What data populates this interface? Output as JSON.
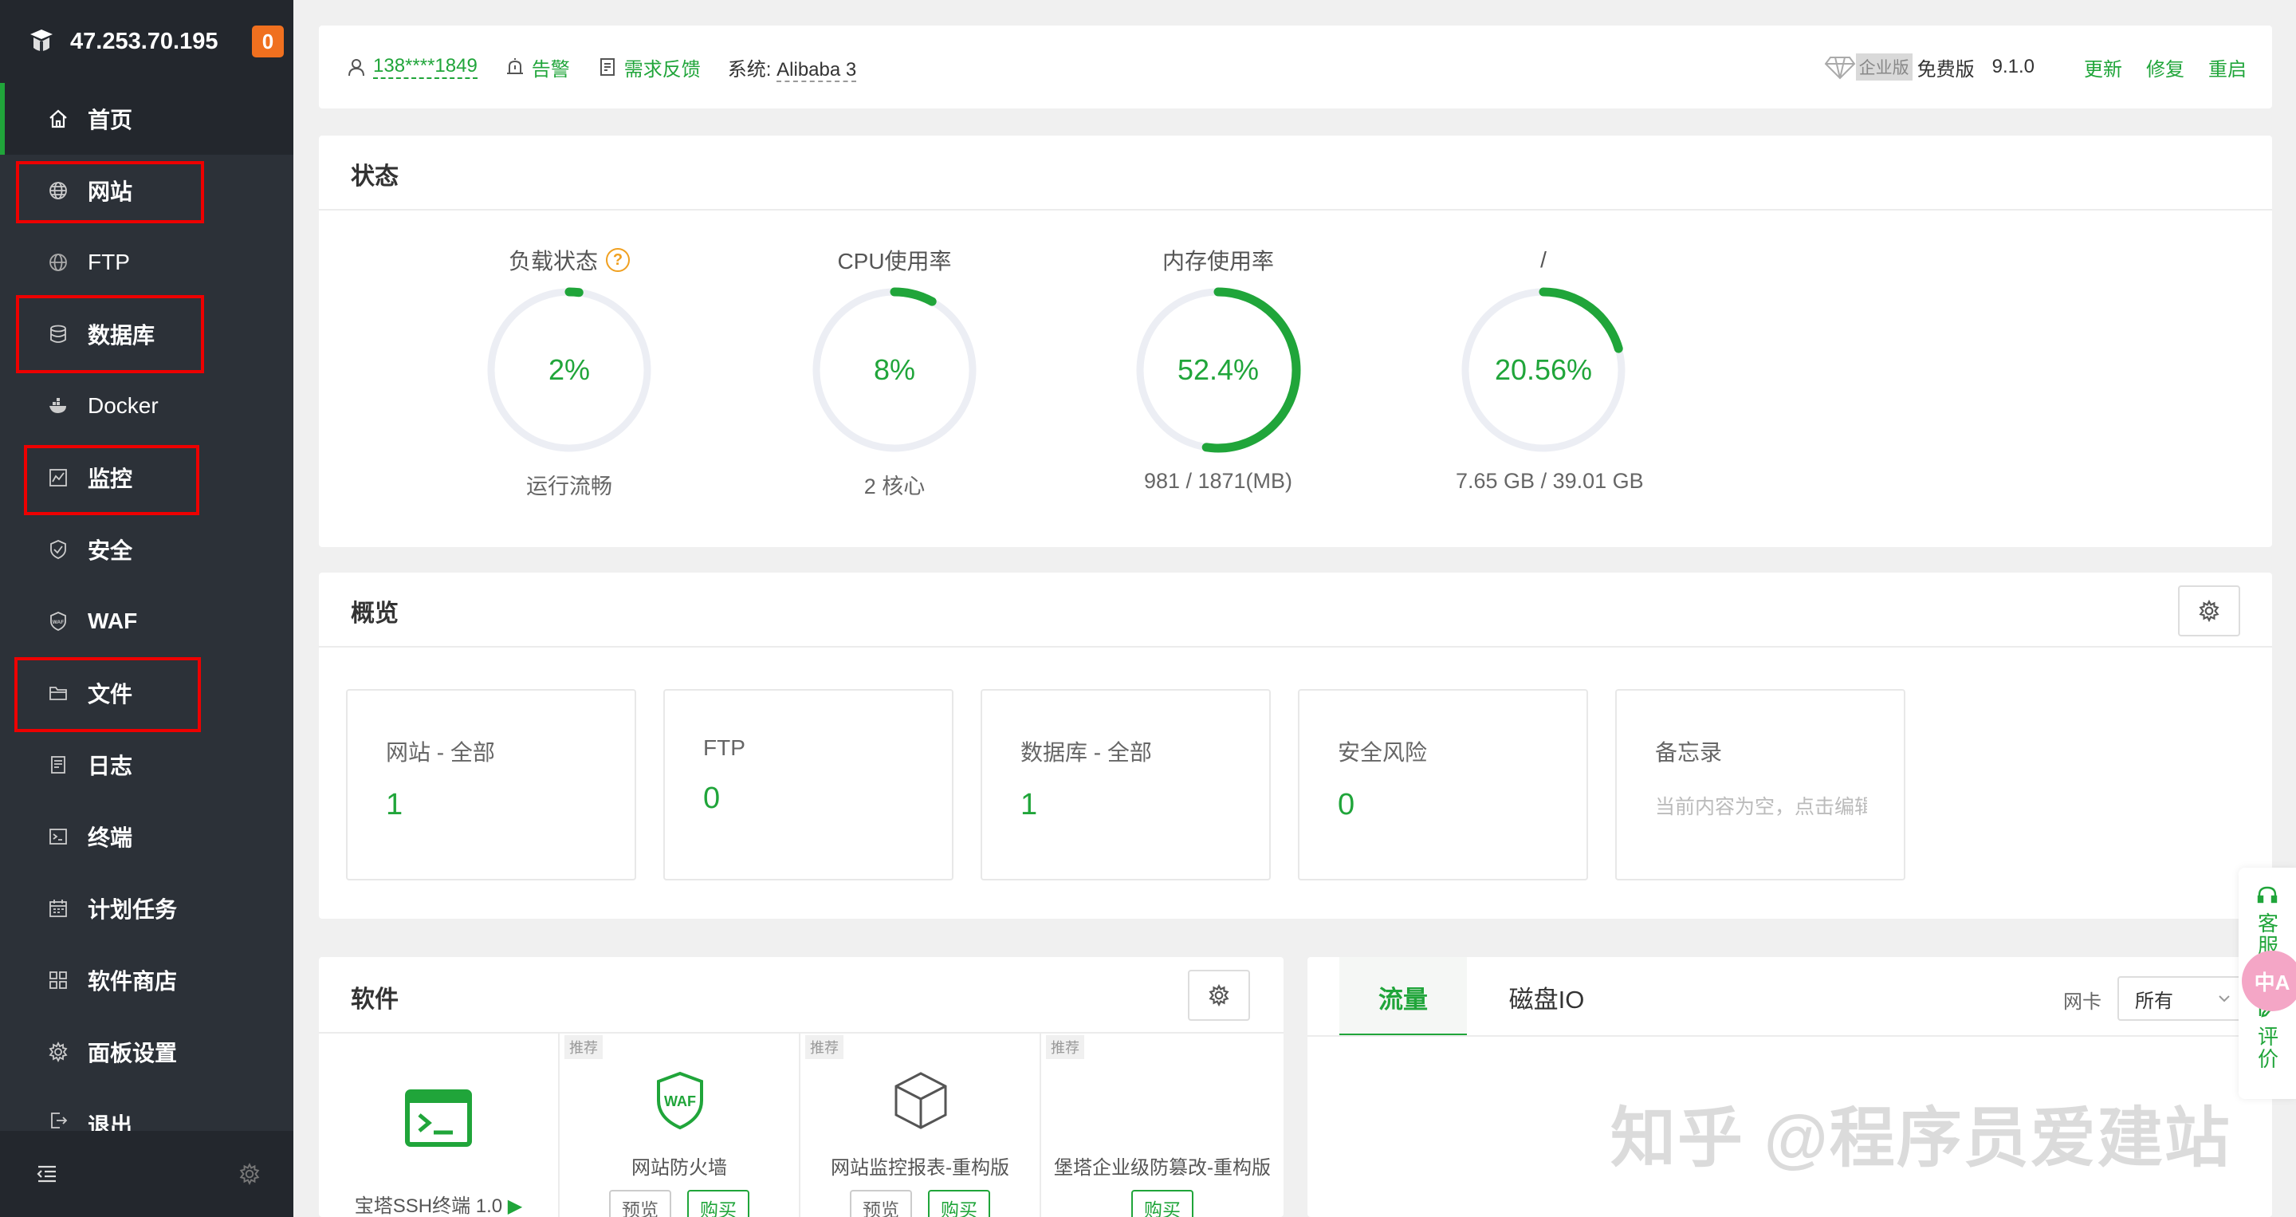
{
  "sidebar": {
    "ip": "47.253.70.195",
    "badge": "0",
    "items": [
      {
        "label": "首页",
        "icon": "home-icon"
      },
      {
        "label": "网站",
        "icon": "globe-icon"
      },
      {
        "label": "FTP",
        "icon": "ftp-globe-icon"
      },
      {
        "label": "数据库",
        "icon": "database-icon"
      },
      {
        "label": "Docker",
        "icon": "docker-icon"
      },
      {
        "label": "监控",
        "icon": "monitor-chart-icon"
      },
      {
        "label": "安全",
        "icon": "shield-check-icon"
      },
      {
        "label": "WAF",
        "icon": "waf-shield-icon"
      },
      {
        "label": "文件",
        "icon": "folder-icon"
      },
      {
        "label": "日志",
        "icon": "log-icon"
      },
      {
        "label": "终端",
        "icon": "terminal-icon"
      },
      {
        "label": "计划任务",
        "icon": "calendar-icon"
      },
      {
        "label": "软件商店",
        "icon": "apps-grid-icon"
      },
      {
        "label": "面板设置",
        "icon": "gear-icon"
      },
      {
        "label": "退出",
        "icon": "logout-icon"
      }
    ]
  },
  "topbar": {
    "user": "138****1849",
    "alarm": "告警",
    "feedback": "需求反馈",
    "system_label": "系统:",
    "system_value": "Alibaba 3",
    "enterprise": "企业版",
    "free": "免费版",
    "version": "9.1.0",
    "update": "更新",
    "repair": "修复",
    "restart": "重启"
  },
  "status": {
    "title": "状态",
    "gauges": [
      {
        "label": "负载状态",
        "value_text": "2%",
        "percent": 2,
        "sub": "运行流畅"
      },
      {
        "label": "CPU使用率",
        "value_text": "8%",
        "percent": 8,
        "sub": "2 核心"
      },
      {
        "label": "内存使用率",
        "value_text": "52.4%",
        "percent": 52.4,
        "sub": "981 / 1871(MB)"
      },
      {
        "label": "/",
        "value_text": "20.56%",
        "percent": 20.56,
        "sub": "7.65 GB / 39.01 GB"
      }
    ],
    "help": "?"
  },
  "overview": {
    "title": "概览",
    "boxes": [
      {
        "title": "网站 - 全部",
        "value": "1"
      },
      {
        "title": "FTP",
        "value": "0"
      },
      {
        "title": "数据库 - 全部",
        "value": "1"
      },
      {
        "title": "安全风险",
        "value": "0"
      },
      {
        "title": "备忘录",
        "memo": "当前内容为空，点击编辑"
      }
    ]
  },
  "software": {
    "title": "软件",
    "recommend": "推荐",
    "items": [
      {
        "name": "宝塔SSH终端 1.0"
      },
      {
        "name": "网站防火墙",
        "preview": "预览",
        "buy": "购买"
      },
      {
        "name": "网站监控报表-重构版",
        "preview": "预览",
        "buy": "购买"
      },
      {
        "name": "堡塔企业级防篡改-重构版",
        "buy": "购买"
      }
    ],
    "waf_text": "WAF"
  },
  "traffic": {
    "tab_traffic": "流量",
    "tab_disk": "磁盘IO",
    "nic_label": "网卡",
    "nic_value": "所有"
  },
  "watermark": "知乎 @程序员爱建站",
  "float": {
    "service": "客服",
    "review": "评价",
    "translate": "中A"
  },
  "colors": {
    "accent": "#20a53a",
    "sidebar": "#2c3138",
    "highlight": "#ee0000",
    "badge": "#f0701f"
  }
}
